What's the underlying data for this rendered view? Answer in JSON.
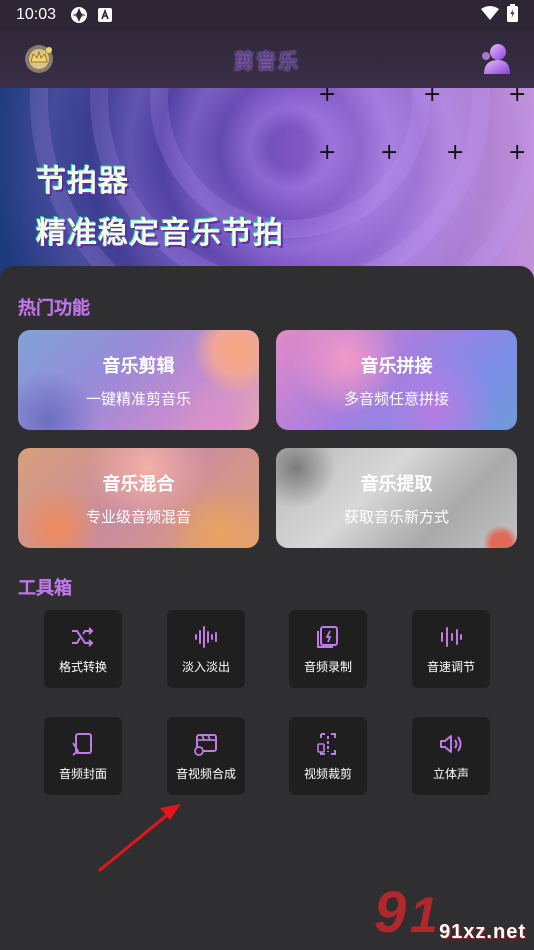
{
  "status_bar": {
    "time": "10:03"
  },
  "app": {
    "title": "剪音乐"
  },
  "banner": {
    "line1": "节拍器",
    "line2": "精准稳定音乐节拍"
  },
  "hot": {
    "title": "热门功能",
    "cards": [
      {
        "title": "音乐剪辑",
        "subtitle": "一键精准剪音乐"
      },
      {
        "title": "音乐拼接",
        "subtitle": "多音频任意拼接"
      },
      {
        "title": "音乐混合",
        "subtitle": "专业级音频混音"
      },
      {
        "title": "音乐提取",
        "subtitle": "获取音乐新方式"
      }
    ]
  },
  "toolbox": {
    "title": "工具箱",
    "tools": [
      {
        "label": "格式转换",
        "icon": "shuffle-icon"
      },
      {
        "label": "淡入淡出",
        "icon": "waveform-icon"
      },
      {
        "label": "音频录制",
        "icon": "record-icon"
      },
      {
        "label": "音速调节",
        "icon": "speed-icon"
      },
      {
        "label": "音频封面",
        "icon": "cover-icon"
      },
      {
        "label": "音视频合成",
        "icon": "merge-icon"
      },
      {
        "label": "视频裁剪",
        "icon": "crop-icon"
      },
      {
        "label": "立体声",
        "icon": "stereo-icon"
      }
    ]
  },
  "watermark": {
    "text": "91xz.net"
  },
  "colors": {
    "accent": "#c07ae6",
    "tile_bg": "#1f1f20",
    "panel_bg": "#2f2f31",
    "annotation_arrow": "#e0161b"
  }
}
